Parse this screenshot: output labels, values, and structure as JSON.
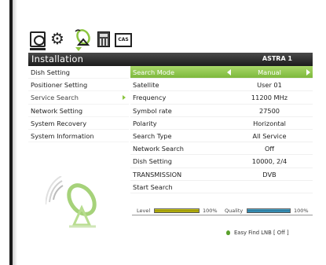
{
  "toolbar": {
    "icons": [
      "tv-icon",
      "gears-icon",
      "satellite-dish-icon",
      "calculator-icon",
      "cas-card-icon"
    ],
    "cas_label": "CAS",
    "accent": "#8bc53f"
  },
  "header": {
    "title": "Installation",
    "satellite": "ASTRA 1"
  },
  "menu": {
    "items": [
      {
        "label": "Dish Setting"
      },
      {
        "label": "Positioner Setting"
      },
      {
        "label": "Service Search"
      },
      {
        "label": "Network Setting"
      },
      {
        "label": "System Recovery"
      },
      {
        "label": "System Information"
      }
    ],
    "active": "Service Search"
  },
  "settings": {
    "rows": [
      {
        "label": "Search Mode",
        "value": "Manual"
      },
      {
        "label": "Satellite",
        "value": "User 01"
      },
      {
        "label": "Frequency",
        "value": "11200 MHz"
      },
      {
        "label": "Symbol rate",
        "value": "27500"
      },
      {
        "label": "Polarity",
        "value": "Horizontal"
      },
      {
        "label": "Search Type",
        "value": "All Service"
      },
      {
        "label": "Network Search",
        "value": "Off"
      },
      {
        "label": "Dish Setting",
        "value": "10000, 2/4"
      },
      {
        "label": "TRANSMISSION",
        "value": "DVB"
      },
      {
        "label": "Start Search",
        "value": ""
      }
    ],
    "selected_color": "#8bc53f"
  },
  "meters": {
    "level_label": "Level",
    "level_value": "100%",
    "level_fraction": 1.0,
    "quality_label": "Quality",
    "quality_value": "100%",
    "quality_fraction": 1.0
  },
  "footer": {
    "hint": "Easy Find LNB [ Off ]"
  }
}
